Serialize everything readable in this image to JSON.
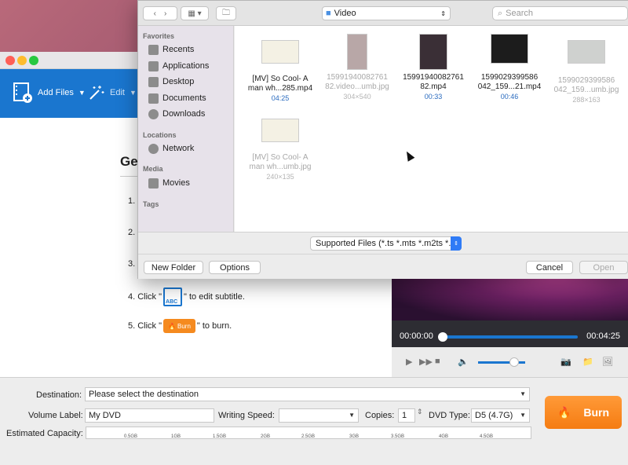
{
  "app": {
    "toolbar": {
      "add_files": "Add Files",
      "edit": "Edit"
    },
    "guide": {
      "title": "Get",
      "steps": [
        "1.",
        "2.",
        "3.",
        "4. Click \"",
        "\" to edit subtitle.",
        "5. Click \"",
        "\" to burn."
      ],
      "burn_mini_label": "Burn"
    },
    "preview": {
      "time_current": "00:00:00",
      "time_total": "00:04:25",
      "seek_progress": 0,
      "volume_level": 0.7
    },
    "settings": {
      "destination_label": "Destination:",
      "destination_value": "Please select the destination",
      "volume_label_label": "Volume Label:",
      "volume_label_value": "My DVD",
      "writing_speed_label": "Writing Speed:",
      "writing_speed_value": "",
      "copies_label": "Copies:",
      "copies_value": "1",
      "dvd_type_label": "DVD Type:",
      "dvd_type_value": "D5 (4.7G)",
      "capacity_label": "Estimated Capacity:",
      "capacity_ticks": [
        "0.5GB",
        "1GB",
        "1.5GB",
        "2GB",
        "2.5GB",
        "3GB",
        "3.5GB",
        "4GB",
        "4.5GB"
      ],
      "burn_button": "Burn"
    }
  },
  "dialog": {
    "location": "Video",
    "search_placeholder": "Search",
    "sidebar": {
      "favorites_heading": "Favorites",
      "favorites": [
        "Recents",
        "Applications",
        "Desktop",
        "Documents",
        "Downloads"
      ],
      "locations_heading": "Locations",
      "locations": [
        "Network"
      ],
      "media_heading": "Media",
      "media": [
        "Movies"
      ],
      "tags_heading": "Tags"
    },
    "files": [
      {
        "line1": "[MV] So Cool- A",
        "line2": "man wh...285.mp4",
        "meta": "04:25",
        "enabled": true
      },
      {
        "line1": "15991940082761",
        "line2": "82.video...umb.jpg",
        "meta": "304×540",
        "enabled": false
      },
      {
        "line1": "15991940082761",
        "line2": "82.mp4",
        "meta": "00:33",
        "enabled": true
      },
      {
        "line1": "1599029399586",
        "line2": "042_159...21.mp4",
        "meta": "00:46",
        "enabled": true
      },
      {
        "line1": "1599029399586",
        "line2": "042_159...umb.jpg",
        "meta": "288×163",
        "enabled": false
      },
      {
        "line1": "[MV] So Cool- A",
        "line2": "man wh...umb.jpg",
        "meta": "240×135",
        "enabled": false
      }
    ],
    "format_filter": "Supported Files (*.ts *.mts *.m2ts *...",
    "new_folder": "New Folder",
    "options": "Options",
    "cancel": "Cancel",
    "open": "Open"
  }
}
